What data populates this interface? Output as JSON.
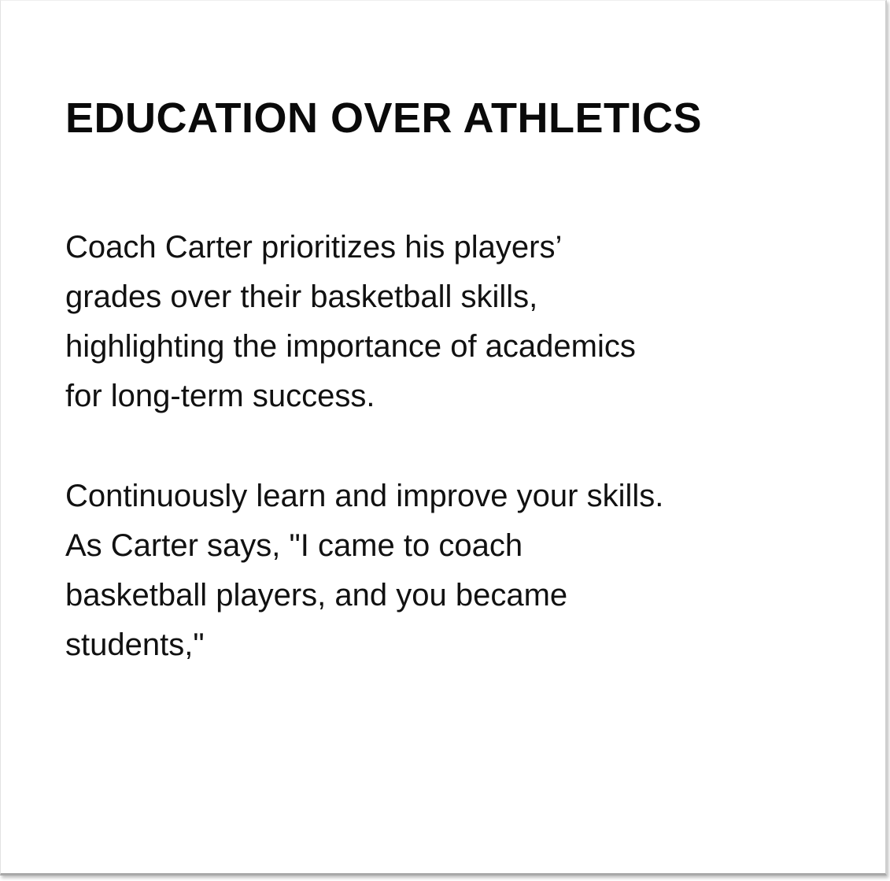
{
  "card": {
    "title": "EDUCATION OVER ATHLETICS",
    "paragraph1": [
      "Coach Carter prioritizes his players’",
      "grades over their basketball skills,",
      "highlighting the importance of academics",
      "for long-term success."
    ],
    "paragraph2": [
      "Continuously learn and improve your skills.",
      "As Carter says, \"I came to coach",
      "basketball players, and you became",
      "students,\""
    ]
  }
}
